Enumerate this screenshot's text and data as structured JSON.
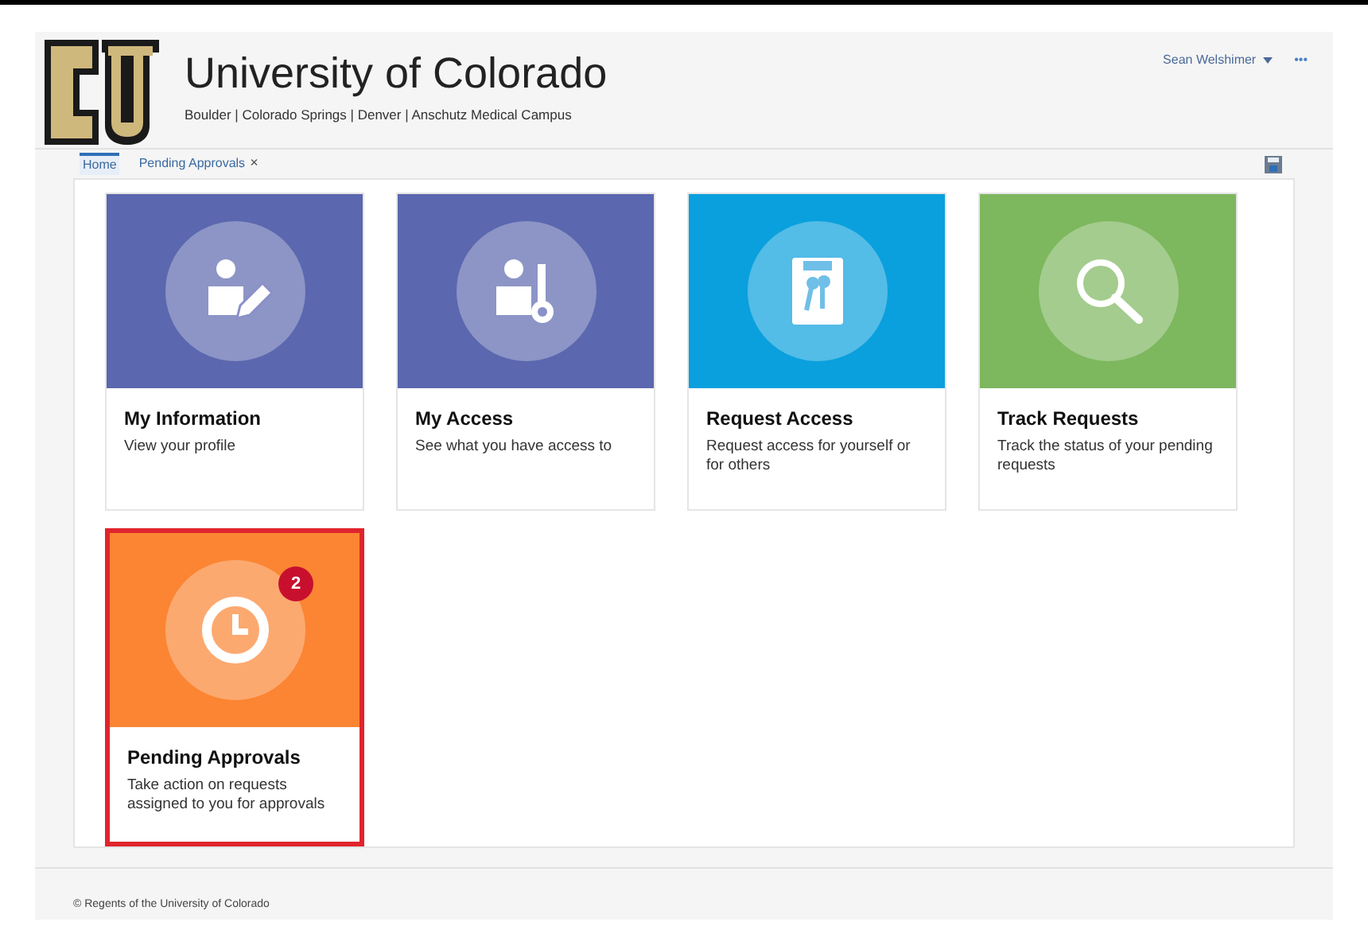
{
  "header": {
    "title": "University of Colorado",
    "subtitle": "Boulder | Colorado Springs | Denver | Anschutz Medical Campus",
    "user": "Sean Welshimer",
    "more": "•••"
  },
  "tabs": [
    {
      "label": "Home",
      "selected": true
    },
    {
      "label": "Pending Approvals",
      "selected": false,
      "close": "×"
    }
  ],
  "tiles": [
    {
      "title": "My Information",
      "description": "View your profile",
      "color": "#5b67ae",
      "selected": false
    },
    {
      "title": "My Access",
      "description": "See what you have access to",
      "color": "#5b67ae",
      "selected": false
    },
    {
      "title": "Request Access",
      "description": "Request access for yourself or for others",
      "color": "#0aa0dd",
      "selected": false
    },
    {
      "title": "Track Requests",
      "description": "Track the status of your pending requests",
      "color": "#7db75e",
      "selected": false
    },
    {
      "title": "Pending Approvals",
      "description": "Take action on requests assigned to you for approvals",
      "color": "#fb8533",
      "selected": true,
      "badge": "2"
    }
  ],
  "footer": "© Regents of the University of Colorado"
}
